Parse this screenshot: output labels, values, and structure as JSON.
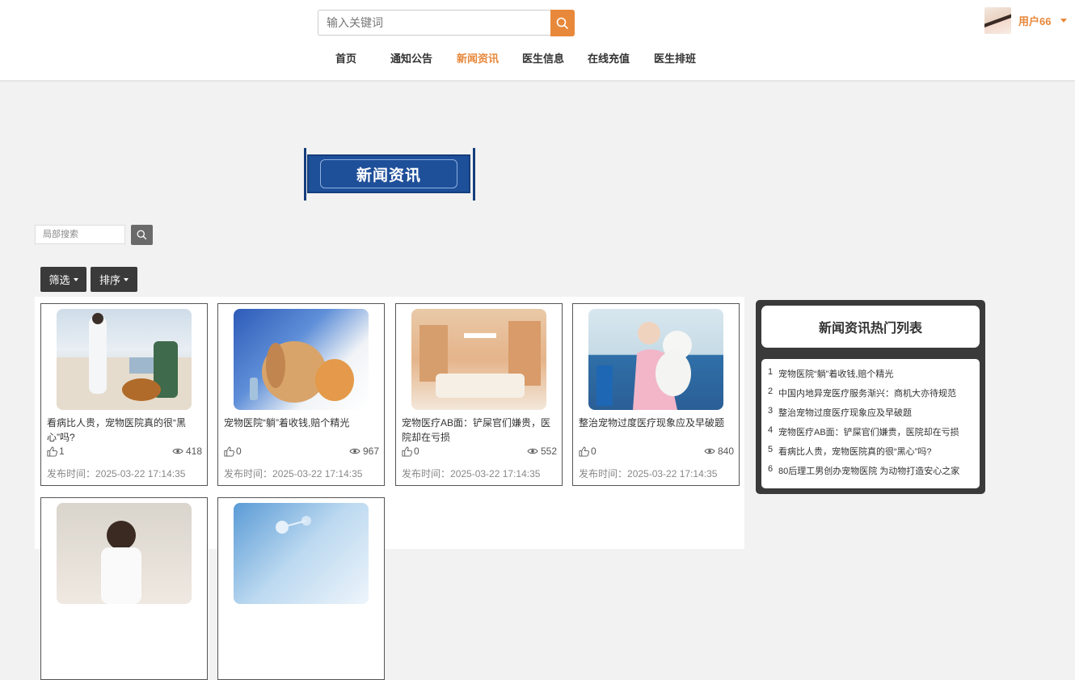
{
  "header": {
    "search_placeholder": "输入关键词",
    "nav": [
      "首页",
      "通知公告",
      "新闻资讯",
      "医生信息",
      "在线充值",
      "医生排班"
    ],
    "active_nav": "新闻资讯",
    "username": "用户66"
  },
  "banner": {
    "title": "新闻资讯"
  },
  "filters": {
    "local_search_placeholder": "局部搜索",
    "filter_label": "筛选",
    "sort_label": "排序"
  },
  "cards": [
    {
      "title": "看病比人贵，宠物医院真的很“黑心”吗?",
      "likes": "1",
      "views": "418",
      "date_label": "发布时间：",
      "date": "2025-03-22 17:14:35"
    },
    {
      "title": "宠物医院“躺”着收钱,赔个精光",
      "likes": "0",
      "views": "967",
      "date_label": "发布时间：",
      "date": "2025-03-22 17:14:35"
    },
    {
      "title": "宠物医疗AB面：铲屎官们嫌贵，医院却在亏损",
      "likes": "0",
      "views": "552",
      "date_label": "发布时间：",
      "date": "2025-03-22 17:14:35"
    },
    {
      "title": "整治宠物过度医疗现象应及早破题",
      "likes": "0",
      "views": "840",
      "date_label": "发布时间：",
      "date": "2025-03-22 17:14:35"
    }
  ],
  "hot_list": {
    "title": "新闻资讯热门列表",
    "items": [
      {
        "num": "1",
        "text": "宠物医院“躺”着收钱,赔个精光"
      },
      {
        "num": "2",
        "text": "中国内地异宠医疗服务渐兴：商机大亦待规范"
      },
      {
        "num": "3",
        "text": "整治宠物过度医疗现象应及早破题"
      },
      {
        "num": "4",
        "text": "宠物医疗AB面：铲屎官们嫌贵，医院却在亏损"
      },
      {
        "num": "5",
        "text": "看病比人贵，宠物医院真的很“黑心”吗?"
      },
      {
        "num": "6",
        "text": "80后理工男创办宠物医院 为动物打造安心之家"
      }
    ]
  },
  "colors": {
    "accent": "#e8883a",
    "banner": "#1e4f99",
    "dark_button": "#3a3a3a"
  }
}
